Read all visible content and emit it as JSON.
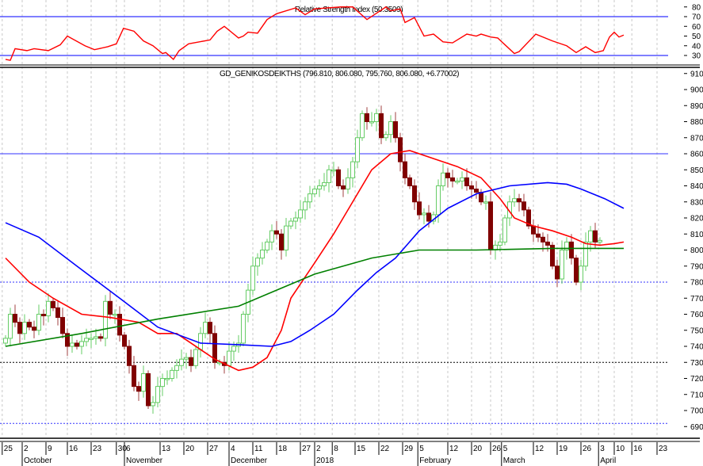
{
  "chart_data": [
    {
      "type": "line",
      "title": "Relative Strength Index (50.3509)",
      "ylim": [
        22,
        84
      ],
      "yticks": [
        30,
        40,
        50,
        60,
        70,
        80
      ],
      "reference_lines": [
        70,
        30
      ],
      "series": [
        {
          "name": "RSI",
          "color": "#ff0000",
          "points": [
            [
              0,
              26
            ],
            [
              1,
              25
            ],
            [
              2,
              37
            ],
            [
              4.5,
              35
            ],
            [
              6,
              37
            ],
            [
              9,
              35
            ],
            [
              11.5,
              41
            ],
            [
              13,
              50
            ],
            [
              16.7,
              40
            ],
            [
              18.7,
              36
            ],
            [
              21.5,
              39
            ],
            [
              23.3,
              42
            ],
            [
              24.8,
              58
            ],
            [
              27,
              55
            ],
            [
              29,
              45
            ],
            [
              31,
              40
            ],
            [
              33,
              32
            ],
            [
              33.7,
              33
            ],
            [
              35.3,
              26
            ],
            [
              36.5,
              35
            ],
            [
              38.5,
              42
            ],
            [
              43,
              46
            ],
            [
              44.5,
              55
            ],
            [
              46,
              60
            ],
            [
              49,
              48
            ],
            [
              50,
              50
            ],
            [
              51,
              54
            ],
            [
              53,
              53
            ],
            [
              55,
              67
            ],
            [
              57,
              73
            ],
            [
              61,
              79
            ],
            [
              63,
              72
            ],
            [
              65,
              78
            ],
            [
              70.5,
              80
            ],
            [
              73,
              80
            ],
            [
              76,
              67
            ],
            [
              80,
              80
            ],
            [
              81,
              76
            ],
            [
              83,
              78
            ],
            [
              84,
              64
            ],
            [
              86,
              69
            ],
            [
              88,
              50
            ],
            [
              90,
              52
            ],
            [
              92,
              44
            ],
            [
              94,
              43
            ],
            [
              97,
              52
            ],
            [
              99,
              50
            ],
            [
              100,
              52
            ],
            [
              102,
              49
            ],
            [
              103.5,
              48
            ],
            [
              107,
              32
            ],
            [
              108,
              34
            ],
            [
              111.5,
              52
            ],
            [
              115,
              45
            ],
            [
              118,
              40
            ],
            [
              120,
              33
            ],
            [
              122,
              39
            ],
            [
              124,
              33
            ],
            [
              125.7,
              35
            ],
            [
              127,
              49
            ],
            [
              128,
              54
            ],
            [
              129,
              49
            ],
            [
              130,
              51
            ]
          ]
        }
      ]
    },
    {
      "type": "candlestick",
      "title": "GD_GENIKOSDEIKTHS (796.810, 806.080, 795.760, 806.080, +6.77002)",
      "ylim": [
        686,
        914
      ],
      "yticks": [
        690,
        700,
        710,
        720,
        730,
        740,
        750,
        760,
        770,
        780,
        790,
        800,
        810,
        820,
        830,
        840,
        850,
        860,
        870,
        880,
        890,
        900,
        910
      ],
      "closes": [
        745,
        760,
        755,
        748,
        755,
        752,
        750,
        760,
        759,
        768,
        764,
        758,
        748,
        740,
        742,
        740,
        743,
        745,
        745,
        746,
        745,
        768,
        760,
        760,
        747,
        740,
        728,
        715,
        712,
        723,
        703,
        705,
        715,
        720,
        720,
        725,
        728,
        732,
        733,
        728,
        738,
        748,
        755,
        748,
        730,
        730,
        728,
        737,
        740,
        742,
        760,
        775,
        790,
        795,
        800,
        805,
        812,
        810,
        800,
        815,
        818,
        820,
        825,
        830,
        835,
        838,
        840,
        842,
        850,
        850,
        840,
        838,
        845,
        855,
        870,
        885,
        880,
        880,
        885,
        870,
        872,
        880,
        870,
        855,
        845,
        840,
        830,
        822,
        823,
        818,
        822,
        840,
        848,
        845,
        843,
        843,
        845,
        840,
        838,
        836,
        830,
        830,
        800,
        803,
        805,
        820,
        830,
        832,
        830,
        825,
        815,
        810,
        808,
        805,
        803,
        790,
        782,
        800,
        805,
        795,
        780,
        790,
        805,
        812,
        805,
        806
      ],
      "moving_averages": [
        {
          "name": "MA short",
          "color": "#ff0000",
          "points": [
            [
              0,
              795
            ],
            [
              5,
              780
            ],
            [
              10,
              770
            ],
            [
              16,
              760
            ],
            [
              22,
              758
            ],
            [
              28,
              755
            ],
            [
              32,
              748
            ],
            [
              36,
              748
            ],
            [
              39,
              742
            ],
            [
              44,
              732
            ],
            [
              49,
              725
            ],
            [
              52,
              727
            ],
            [
              55,
              733
            ],
            [
              58,
              750
            ],
            [
              60,
              770
            ],
            [
              65,
              792
            ],
            [
              69,
              810
            ],
            [
              73,
              830
            ],
            [
              77,
              850
            ],
            [
              81,
              860
            ],
            [
              85,
              862
            ],
            [
              90,
              857
            ],
            [
              95,
              852
            ],
            [
              100,
              845
            ],
            [
              104,
              832
            ],
            [
              107,
              820
            ],
            [
              111,
              815
            ],
            [
              115,
              812
            ],
            [
              119,
              808
            ],
            [
              122,
              804
            ],
            [
              125,
              803
            ],
            [
              128,
              804
            ],
            [
              130,
              805
            ]
          ]
        },
        {
          "name": "MA medium",
          "color": "#0000ff",
          "points": [
            [
              0,
              817
            ],
            [
              7,
              808
            ],
            [
              15,
              790
            ],
            [
              24,
              770
            ],
            [
              32,
              752
            ],
            [
              41,
              742
            ],
            [
              49,
              741
            ],
            [
              56,
              740
            ],
            [
              60,
              743
            ],
            [
              64,
              750
            ],
            [
              69,
              760
            ],
            [
              74,
              775
            ],
            [
              78,
              786
            ],
            [
              82,
              795
            ],
            [
              87,
              812
            ],
            [
              93,
              826
            ],
            [
              99,
              835
            ],
            [
              106,
              840
            ],
            [
              114,
              842
            ],
            [
              118,
              841
            ],
            [
              121,
              838
            ],
            [
              126,
              832
            ],
            [
              130,
              826
            ]
          ]
        },
        {
          "name": "MA long",
          "color": "#008000",
          "points": [
            [
              0,
              740
            ],
            [
              16,
              748
            ],
            [
              32,
              757
            ],
            [
              49,
              765
            ],
            [
              57,
              775
            ],
            [
              65,
              785
            ],
            [
              77,
              795
            ],
            [
              87,
              800
            ],
            [
              99,
              800
            ],
            [
              115,
              801
            ],
            [
              130,
              801
            ]
          ]
        }
      ],
      "reference_lines": [
        {
          "value": 860,
          "style": "solid"
        },
        {
          "value": 780,
          "style": "dotted"
        },
        {
          "value": 730,
          "style": "dotted-black"
        },
        {
          "value": 692,
          "style": "dotted"
        }
      ]
    }
  ],
  "x_axis": {
    "day_ticks": [
      [
        "25",
        -0.7
      ],
      [
        "2",
        3.5
      ],
      [
        "9",
        8.5
      ],
      [
        "16",
        13
      ],
      [
        "23",
        18
      ],
      [
        "30",
        23.3
      ],
      [
        "6",
        25
      ],
      [
        "13",
        32.5
      ],
      [
        "20",
        37.5
      ],
      [
        "27",
        42.5
      ],
      [
        "4",
        47
      ],
      [
        "11",
        52
      ],
      [
        "18",
        57
      ],
      [
        "27",
        62
      ],
      [
        "2",
        65
      ],
      [
        "8",
        68.7
      ],
      [
        "15",
        73.5
      ],
      [
        "22",
        78.5
      ],
      [
        "29",
        83.5
      ],
      [
        "5",
        86.7
      ],
      [
        "12",
        93
      ],
      [
        "20",
        98
      ],
      [
        "26",
        102
      ],
      [
        "5",
        104.3
      ],
      [
        "12",
        111
      ],
      [
        "19",
        116
      ],
      [
        "26",
        121
      ],
      [
        "3",
        124.7
      ],
      [
        "10",
        128
      ],
      [
        "16",
        131.7
      ],
      [
        "23",
        137
      ]
    ],
    "months": [
      [
        "October",
        3.5
      ],
      [
        "November",
        25
      ],
      [
        "December",
        47
      ],
      [
        "2018",
        65
      ],
      [
        "February",
        86.7
      ],
      [
        "March",
        104.3
      ],
      [
        "April",
        124.7
      ]
    ]
  },
  "colors": {
    "up": "#66cc66",
    "down": "#800000",
    "rsi": "#ff0000",
    "ref": "#3333ff"
  }
}
